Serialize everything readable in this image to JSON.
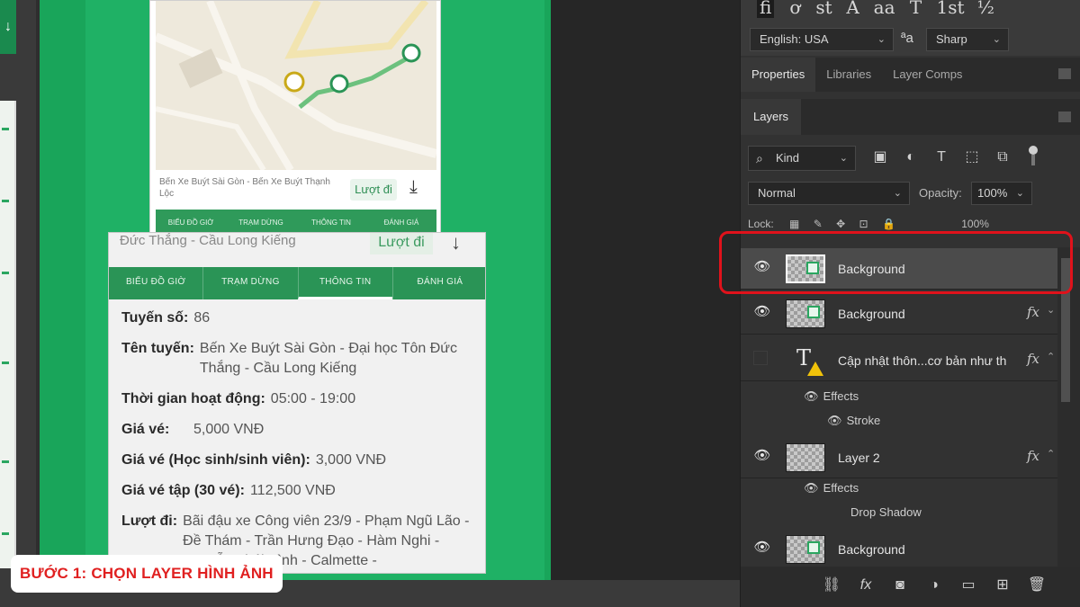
{
  "canvas": {
    "map": {
      "caption": "Bến Xe Buýt Sài Gòn - Bến Xe Buýt Thạnh Lộc",
      "go_button": "Lượt đi",
      "tabs": [
        "BIỂU ĐỒ GIỜ",
        "TRẠM DỪNG",
        "THÔNG TIN",
        "ĐÁNH GIÁ"
      ]
    },
    "info": {
      "header_text": "Đức Thắng - Cầu Long Kiếng",
      "go_button": "Lượt đi",
      "tabs": [
        "BIỂU ĐỒ GIỜ",
        "TRẠM DỪNG",
        "THÔNG TIN",
        "ĐÁNH GIÁ"
      ],
      "active_tab": "THÔNG TIN",
      "rows": [
        {
          "k": "Tuyến số:",
          "v": "86"
        },
        {
          "k": "Tên tuyến:",
          "v": "Bến Xe Buýt Sài Gòn - Đại học Tôn Đức Thắng - Cầu Long Kiếng"
        },
        {
          "k": "Thời gian hoạt động:",
          "v": "05:00 - 19:00"
        },
        {
          "k": "Giá vé:",
          "v": "5,000 VNĐ"
        },
        {
          "k": "Giá vé (Học sinh/sinh viên):",
          "v": "3,000 VNĐ"
        },
        {
          "k": "Giá vé tập (30 vé):",
          "v": "112,500 VNĐ"
        },
        {
          "k": "Lượt đi:",
          "v": "Bãi đậu xe Công viên 23/9 - Phạm Ngũ Lão - Đề Thám - Trần Hưng Đạo - Hàm Nghi - Nguyễn Thái Bình - Calmette -"
        }
      ]
    },
    "step_caption": "BƯỚC 1: CHỌN LAYER HÌNH ẢNH"
  },
  "ps": {
    "glyphs": [
      "ﬁ",
      "ơ",
      "st",
      "A",
      "aa",
      "T",
      "1st",
      "½"
    ],
    "language": "English: USA",
    "aa_icon": "ªa",
    "antialias": "Sharp",
    "tabs": [
      "Properties",
      "Libraries",
      "Layer Comps"
    ],
    "active_tab": "Properties",
    "layers_tab": "Layers",
    "kind": "Kind",
    "blend_mode": "Normal",
    "opacity_label": "Opacity:",
    "opacity": "100%",
    "lock_label": "Lock:",
    "fill": "100%",
    "layers": [
      {
        "name": "Background",
        "visible": true,
        "selected": true,
        "fx": false
      },
      {
        "name": "Background",
        "visible": true,
        "selected": false,
        "fx": true
      },
      {
        "name": "Cập nhật thôn...cơ bản như th",
        "visible": false,
        "selected": false,
        "fx": true,
        "type": "text"
      },
      {
        "name": "Layer 2",
        "visible": true,
        "selected": false,
        "fx": true
      },
      {
        "name": "Background",
        "visible": true,
        "selected": false,
        "fx": false
      }
    ],
    "effects": {
      "text_layer": {
        "label": "Effects",
        "items": [
          "Stroke"
        ]
      },
      "layer2": {
        "label": "Effects",
        "items": [
          "Drop Shadow"
        ]
      }
    },
    "colors": {
      "highlight": "#e0121b",
      "accent_green": "#2aa660"
    }
  }
}
